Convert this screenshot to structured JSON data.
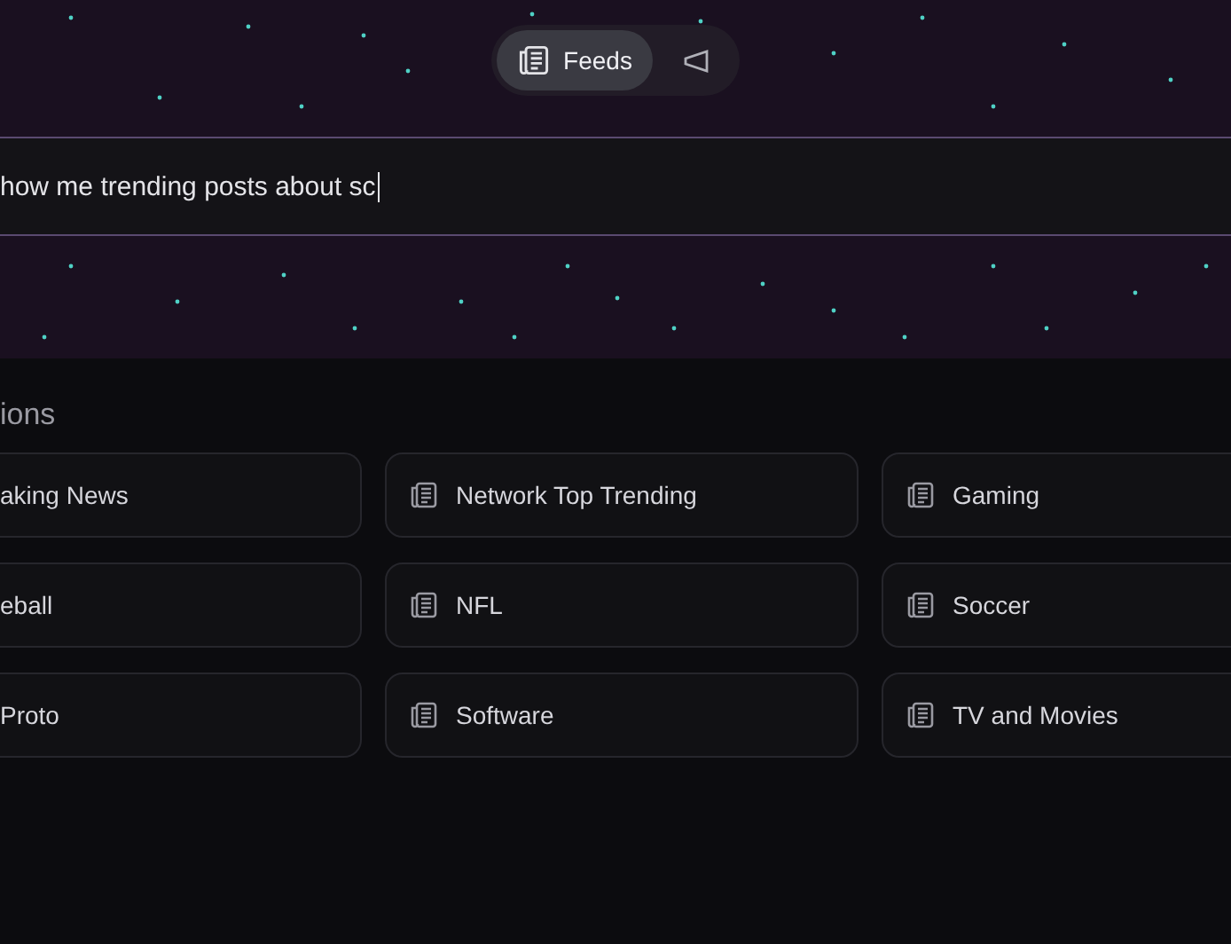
{
  "view_switch": [
    {
      "kind": "feeds",
      "label": "Feeds",
      "selected": true
    },
    {
      "kind": "announce",
      "selected": false
    }
  ],
  "prompt_field": {
    "value": "how me trending posts about sc",
    "focused": true
  },
  "suggestions": {
    "heading": "ions",
    "items": [
      {
        "kind": "clipped",
        "label": "aking News"
      },
      {
        "kind": "full",
        "label": "Network Top Trending"
      },
      {
        "kind": "full",
        "label": "Gaming"
      },
      {
        "kind": "clipped",
        "label": "eball"
      },
      {
        "kind": "full",
        "label": "NFL"
      },
      {
        "kind": "full",
        "label": "Soccer"
      },
      {
        "kind": "clipped",
        "label": "Proto"
      },
      {
        "kind": "full",
        "label": "Software"
      },
      {
        "kind": "full",
        "label": "TV and Movies"
      }
    ]
  }
}
